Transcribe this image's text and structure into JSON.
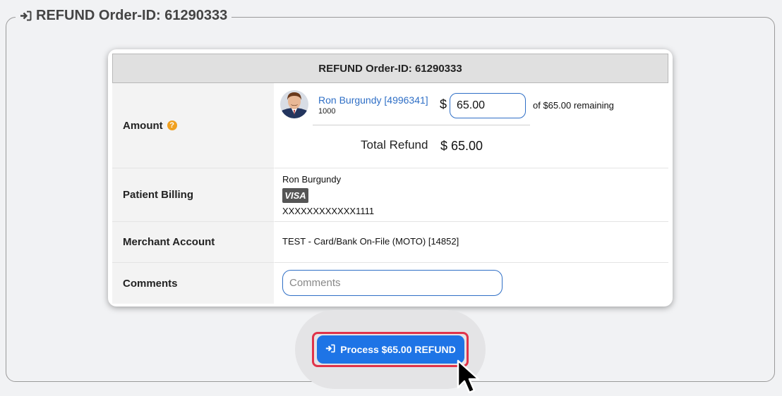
{
  "legend": {
    "title": "REFUND Order-ID: 61290333",
    "icon": "sign-in-icon"
  },
  "card": {
    "header": "REFUND Order-ID: 61290333",
    "amount": {
      "label": "Amount",
      "help_icon": "question-circle-icon",
      "help_glyph": "?",
      "patient_name": "Ron Burgundy [4996341]",
      "patient_sub": "1000",
      "currency": "$",
      "value": "65.00",
      "remaining_text": "of  $65.00 remaining",
      "total_label": "Total Refund",
      "total_value": "$ 65.00"
    },
    "billing": {
      "label": "Patient Billing",
      "name": "Ron Burgundy",
      "card_brand": "VISA",
      "card_number": "XXXXXXXXXXXX1111"
    },
    "merchant": {
      "label": "Merchant Account",
      "value": "TEST - Card/Bank On-File (MOTO) [14852]"
    },
    "comments": {
      "label": "Comments",
      "placeholder": "Comments"
    }
  },
  "action": {
    "button_label": "Process $65.00 REFUND",
    "icon": "sign-in-icon"
  },
  "colors": {
    "accent": "#1e74e6",
    "highlight": "#e0334a",
    "link": "#2f6fc6",
    "help": "#f0a020"
  }
}
